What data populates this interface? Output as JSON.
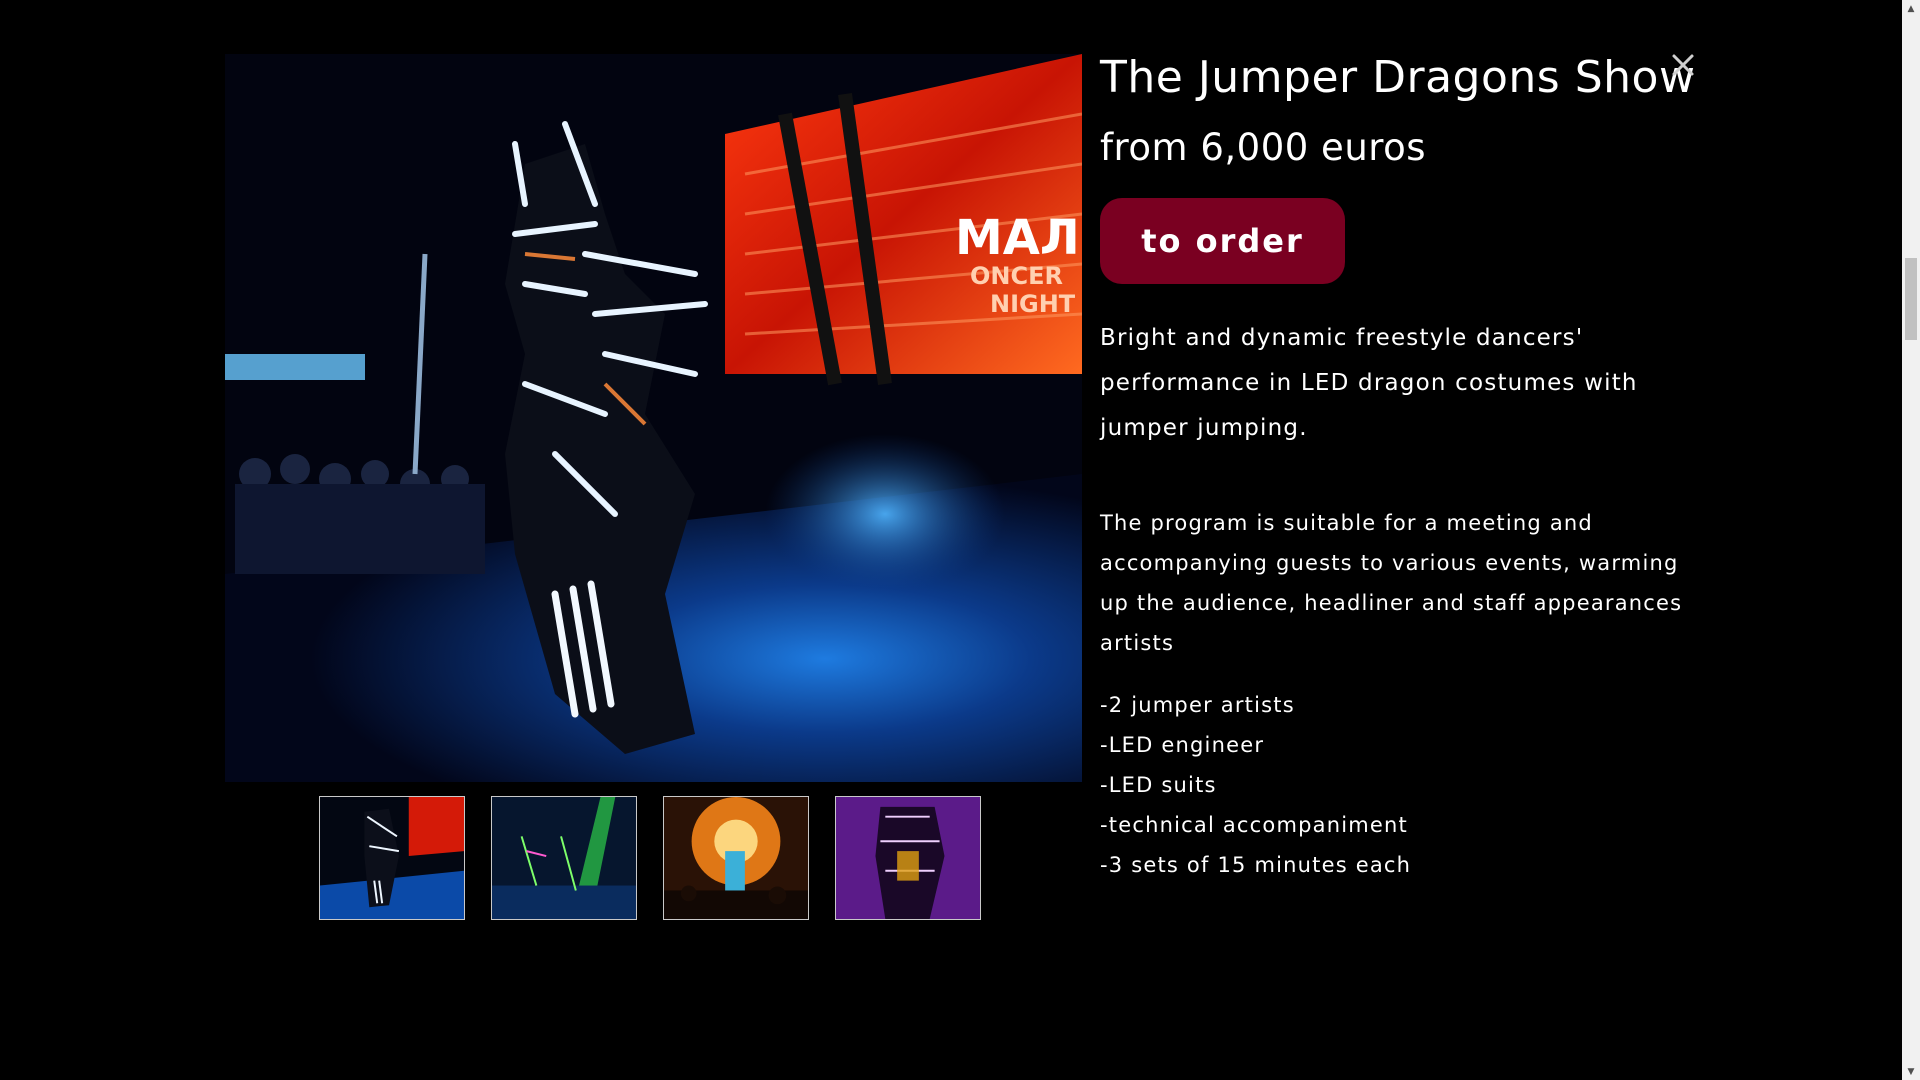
{
  "modal": {
    "title": "The Jumper Dragons Show",
    "price": "from 6,000 euros",
    "order_label": "to order",
    "description": "Bright and dynamic freestyle dancers' performance in LED dragon costumes with jumper jumping.",
    "program_text": "The program is suitable for a meeting and accompanying guests to various events, warming up the audience, headliner and staff appearances artists",
    "features": [
      "-2 jumper artists",
      "-LED engineer",
      "-LED suits",
      "-technical accompaniment",
      "-3 sets of 15 minutes each"
    ],
    "close_icon": "close-icon"
  },
  "gallery": {
    "main_image": "led-dragon-dancer-on-stage",
    "thumbnails": [
      "led-dancer-stage-blue",
      "led-dancers-green-lasers",
      "concert-crowd-orange",
      "led-costume-purple"
    ]
  },
  "colors": {
    "background": "#000000",
    "accent_button": "#7a0021",
    "text": "#ffffff"
  }
}
